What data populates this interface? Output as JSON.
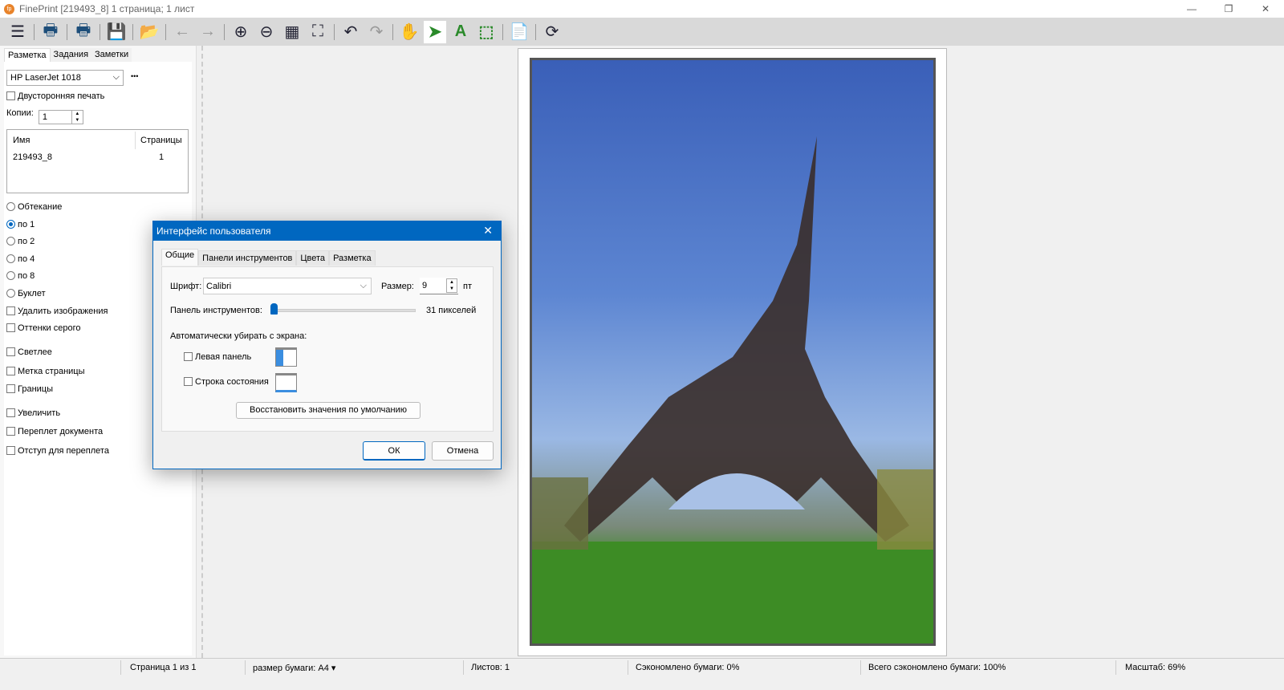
{
  "window": {
    "title": "FinePrint [219493_8] 1 страница; 1 лист",
    "logo_text": "fp",
    "minimize": "—",
    "maximize": "❐",
    "close": "✕"
  },
  "toolbar": [
    {
      "name": "menu-icon",
      "glyph": "☰"
    },
    {
      "sep": true
    },
    {
      "name": "print-icon",
      "glyph": "🖶"
    },
    {
      "sep": true
    },
    {
      "name": "print-close-icon",
      "glyph": "🖶"
    },
    {
      "sep": true
    },
    {
      "name": "save-icon",
      "glyph": "💾"
    },
    {
      "sep": true
    },
    {
      "name": "open-folder-icon",
      "glyph": "📂"
    },
    {
      "sep": true
    },
    {
      "name": "back-arrow-icon",
      "glyph": "←"
    },
    {
      "name": "forward-arrow-icon",
      "glyph": "→"
    },
    {
      "sep": true
    },
    {
      "name": "zoom-in-icon",
      "glyph": "⊕"
    },
    {
      "name": "zoom-out-icon",
      "glyph": "⊖"
    },
    {
      "name": "grid-icon",
      "glyph": "▦"
    },
    {
      "name": "fit-page-icon",
      "glyph": "⛶"
    },
    {
      "sep": true
    },
    {
      "name": "undo-icon",
      "glyph": "↶"
    },
    {
      "name": "redo-icon",
      "glyph": "↷"
    },
    {
      "sep": true
    },
    {
      "name": "hand-icon",
      "glyph": "✋"
    },
    {
      "name": "pointer-icon",
      "glyph": "➤",
      "active": true
    },
    {
      "name": "text-tool-icon",
      "glyph": "A"
    },
    {
      "name": "select-region-icon",
      "glyph": "⬚"
    },
    {
      "sep": true
    },
    {
      "name": "document-icon",
      "glyph": "📄"
    },
    {
      "sep": true
    },
    {
      "name": "refresh-icon",
      "glyph": "⟳"
    }
  ],
  "left": {
    "tabs": [
      "Разметка",
      "Задания",
      "Заметки"
    ],
    "printer": "HP LaserJet 1018",
    "more": "•••",
    "duplex": "Двусторонняя печать",
    "copies_label": "Копии:",
    "copies": "1",
    "jobs": {
      "headers": [
        "Имя",
        "Страницы"
      ],
      "rows": [
        [
          "219493_8",
          "1"
        ]
      ]
    },
    "layouts": [
      {
        "label": "Обтекание",
        "checked": false
      },
      {
        "label": "по 1",
        "checked": true
      },
      {
        "label": "по 2",
        "checked": false
      },
      {
        "label": "по 4",
        "checked": false
      },
      {
        "label": "по 8",
        "checked": false
      },
      {
        "label": "Буклет",
        "checked": false
      }
    ],
    "options": [
      "Удалить изображения",
      "Оттенки серого",
      "Светлее",
      "Метка страницы",
      "Границы",
      "Увеличить",
      "Переплет документа",
      "Отступ для переплета"
    ]
  },
  "dialog": {
    "title": "Интерфейс пользователя",
    "tabs": [
      "Общие",
      "Панели инструментов",
      "Цвета",
      "Разметка"
    ],
    "font_label": "Шрифт:",
    "font": "Calibri",
    "size_label": "Размер:",
    "size": "9",
    "size_unit": "пт",
    "toolbar_label": "Панель инструментов:",
    "toolbar_value": "31 пикселей",
    "toolbar_slider_fraction": 0,
    "autohide_label": "Автоматически убирать с экрана:",
    "left_panel": "Левая панель",
    "status_bar": "Строка состояния",
    "restore": "Восстановить значения по умолчанию",
    "ok": "ОК",
    "cancel": "Отмена"
  },
  "status": {
    "page": "Страница 1 из 1",
    "paper": "размер бумаги: A4",
    "sheets": "Листов: 1",
    "saved": "Сэкономлено бумаги: 0%",
    "total_saved": "Всего сэкономлено бумаги: 100%",
    "zoom": "Масштаб: 69%"
  },
  "colors": {
    "accent": "#0067c0",
    "toolbar_bg": "#d9d9d9"
  }
}
